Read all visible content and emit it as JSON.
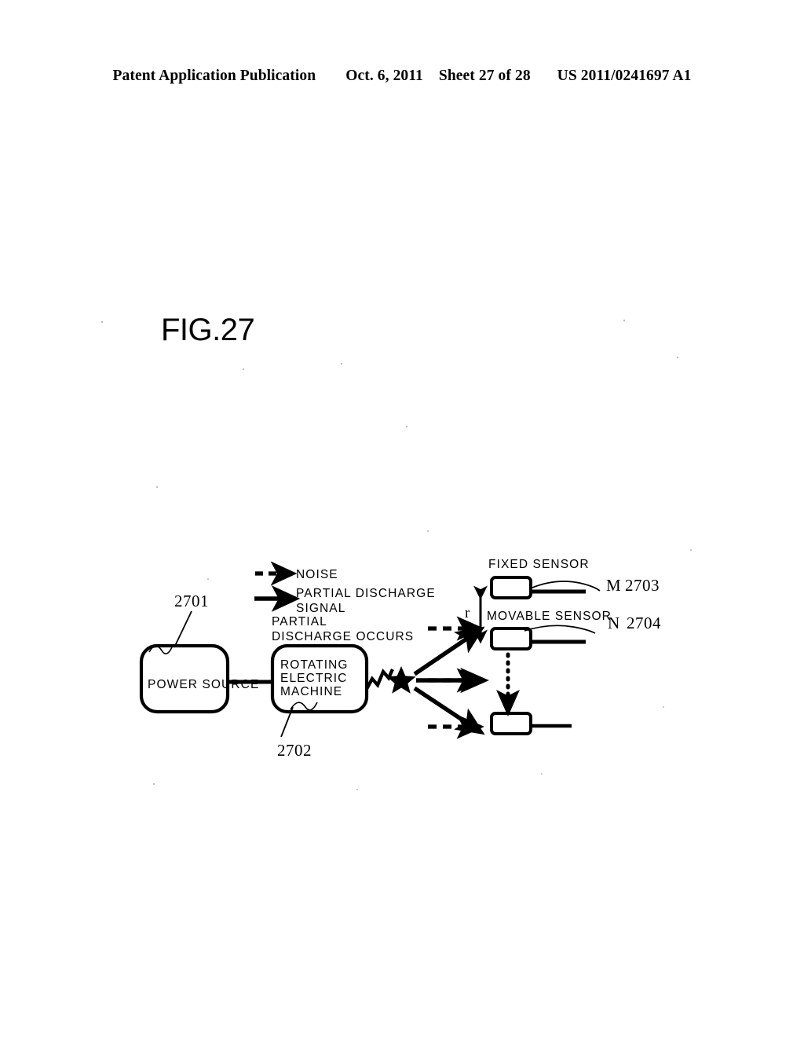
{
  "header": {
    "publication": "Patent Application Publication",
    "date": "Oct. 6, 2011",
    "sheet": "Sheet 27 of 28",
    "patent_number": "US 2011/0241697 A1"
  },
  "figure": {
    "label": "FIG.27"
  },
  "legend": {
    "noise": "NOISE",
    "signal_line1": "PARTIAL DISCHARGE",
    "signal_line2": "SIGNAL"
  },
  "diagram": {
    "discharge_note_line1": "PARTIAL",
    "discharge_note_line2": "DISCHARGE OCCURS",
    "power_source": "POWER SOURCE",
    "machine_line1": "ROTATING",
    "machine_line2": "ELECTRIC",
    "machine_line3": "MACHINE",
    "fixed_sensor": "FIXED SENSOR",
    "movable_sensor": "MOVABLE SENSOR",
    "distance_label": "r",
    "ref_2701": "2701",
    "ref_2702": "2702",
    "ref_m": "M",
    "ref_2703": "2703",
    "ref_n": "N",
    "ref_2704": "2704"
  }
}
